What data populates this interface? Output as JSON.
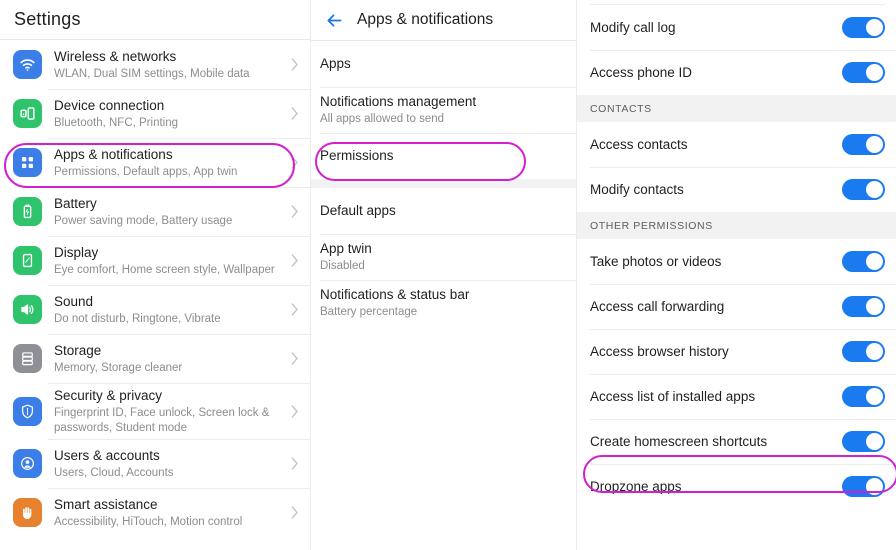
{
  "settings_panel": {
    "title": "Settings",
    "items": [
      {
        "title": "Wireless & networks",
        "subtitle": "WLAN, Dual SIM settings, Mobile data",
        "icon": "wifi-icon",
        "icon_color": "#3b7ee8"
      },
      {
        "title": "Device connection",
        "subtitle": "Bluetooth, NFC, Printing",
        "icon": "device-connection-icon",
        "icon_color": "#2fc46b"
      },
      {
        "title": "Apps & notifications",
        "subtitle": "Permissions, Default apps, App twin",
        "icon": "apps-grid-icon",
        "icon_color": "#3b7ee8",
        "highlighted": true
      },
      {
        "title": "Battery",
        "subtitle": "Power saving mode, Battery usage",
        "icon": "battery-icon",
        "icon_color": "#2fc46b"
      },
      {
        "title": "Display",
        "subtitle": "Eye comfort, Home screen style, Wallpaper",
        "icon": "display-icon",
        "icon_color": "#2fc46b"
      },
      {
        "title": "Sound",
        "subtitle": "Do not disturb, Ringtone, Vibrate",
        "icon": "speaker-icon",
        "icon_color": "#2fc46b"
      },
      {
        "title": "Storage",
        "subtitle": "Memory, Storage cleaner",
        "icon": "storage-icon",
        "icon_color": "#8d9196"
      },
      {
        "title": "Security & privacy",
        "subtitle": "Fingerprint ID, Face unlock, Screen lock & passwords, Student mode",
        "icon": "shield-icon",
        "icon_color": "#3b7ee8"
      },
      {
        "title": "Users & accounts",
        "subtitle": "Users, Cloud, Accounts",
        "icon": "user-account-icon",
        "icon_color": "#3b7ee8"
      },
      {
        "title": "Smart assistance",
        "subtitle": "Accessibility, HiTouch, Motion control",
        "icon": "hand-icon",
        "icon_color": "#e8812d"
      }
    ],
    "chevron_icon": "chevron-right-icon"
  },
  "apps_panel": {
    "back_icon": "back-arrow-icon",
    "title": "Apps & notifications",
    "items": [
      {
        "title": "Apps",
        "subtitle": ""
      },
      {
        "title": "Notifications management",
        "subtitle": "All apps allowed to send"
      },
      {
        "title": "Permissions",
        "subtitle": "",
        "highlighted": true
      },
      {
        "title": "Default apps",
        "subtitle": ""
      },
      {
        "title": "App twin",
        "subtitle": "Disabled"
      },
      {
        "title": "Notifications & status bar",
        "subtitle": "Battery percentage"
      }
    ]
  },
  "permissions_panel": {
    "rows": [
      {
        "type": "toggle",
        "label": "Modify call log",
        "on": true
      },
      {
        "type": "toggle",
        "label": "Access phone ID",
        "on": true
      },
      {
        "type": "header",
        "label": "CONTACTS"
      },
      {
        "type": "toggle",
        "label": "Access contacts",
        "on": true
      },
      {
        "type": "toggle",
        "label": "Modify contacts",
        "on": true
      },
      {
        "type": "header",
        "label": "OTHER PERMISSIONS"
      },
      {
        "type": "toggle",
        "label": "Take photos or videos",
        "on": true
      },
      {
        "type": "toggle",
        "label": "Access call forwarding",
        "on": true
      },
      {
        "type": "toggle",
        "label": "Access browser history",
        "on": true
      },
      {
        "type": "toggle",
        "label": "Access list of installed apps",
        "on": true
      },
      {
        "type": "toggle",
        "label": "Create homescreen shortcuts",
        "on": true
      },
      {
        "type": "toggle",
        "label": "Dropzone apps",
        "on": true,
        "highlighted": true
      }
    ]
  },
  "colors": {
    "highlight_oval": "#d21fd2",
    "toggle_on": "#1a7bf0",
    "accent_blue": "#1a73e8",
    "section_header_bg": "#f2f2f2"
  }
}
